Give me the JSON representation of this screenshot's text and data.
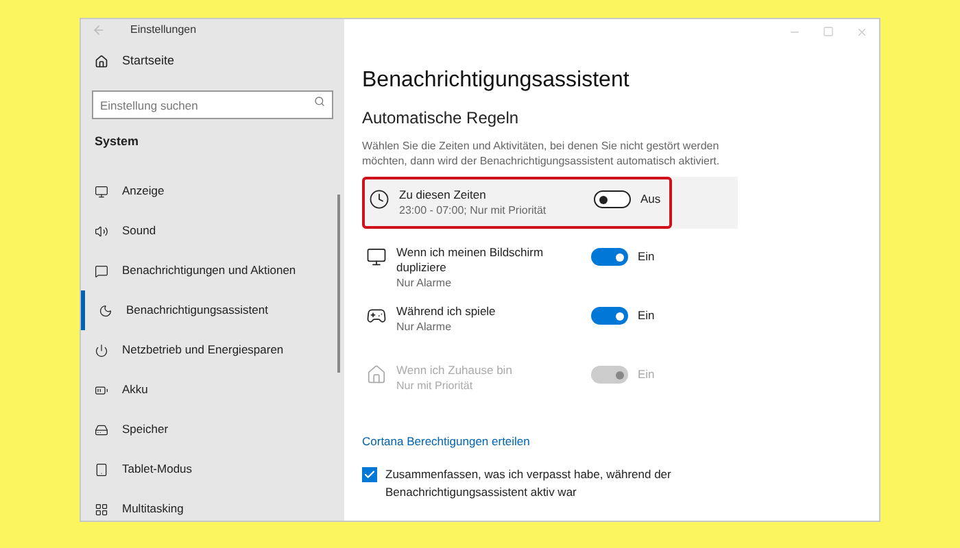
{
  "window": {
    "title": "Einstellungen"
  },
  "sidebar": {
    "home": "Startseite",
    "search": {
      "placeholder": "Einstellung suchen"
    },
    "section": "System",
    "items": [
      {
        "label": "Anzeige",
        "selected": false
      },
      {
        "label": "Sound",
        "selected": false
      },
      {
        "label": "Benachrichtigungen und Aktionen",
        "selected": false
      },
      {
        "label": "Benachrichtigungsassistent",
        "selected": true
      },
      {
        "label": "Netzbetrieb und Energiesparen",
        "selected": false
      },
      {
        "label": "Akku",
        "selected": false
      },
      {
        "label": "Speicher",
        "selected": false
      },
      {
        "label": "Tablet-Modus",
        "selected": false
      },
      {
        "label": "Multitasking",
        "selected": false
      }
    ]
  },
  "main": {
    "title": "Benachrichtigungsassistent",
    "subtitle": "Automatische Regeln",
    "description": "Wählen Sie die Zeiten und Aktivitäten, bei denen Sie nicht gestört werden möchten, dann wird der Benachrichtigungsassistent automatisch aktiviert.",
    "rules": [
      {
        "title": "Zu diesen Zeiten",
        "detail": "23:00 - 07:00; Nur mit Priorität",
        "on": false,
        "state_label": "Aus",
        "disabled": false,
        "highlighted": true
      },
      {
        "title": "Wenn ich meinen Bildschirm dupliziere",
        "detail": "Nur Alarme",
        "on": true,
        "state_label": "Ein",
        "disabled": false,
        "highlighted": false
      },
      {
        "title": "Während ich spiele",
        "detail": "Nur Alarme",
        "on": true,
        "state_label": "Ein",
        "disabled": false,
        "highlighted": false
      },
      {
        "title": "Wenn ich Zuhause bin",
        "detail": "Nur mit Priorität",
        "on": true,
        "state_label": "Ein",
        "disabled": true,
        "highlighted": false
      }
    ],
    "link": "Cortana Berechtigungen erteilen",
    "summary": {
      "label": "Zusammenfassen, was ich verpasst habe, während der Benachrichtigungsassistent aktiv war",
      "checked": true
    }
  }
}
